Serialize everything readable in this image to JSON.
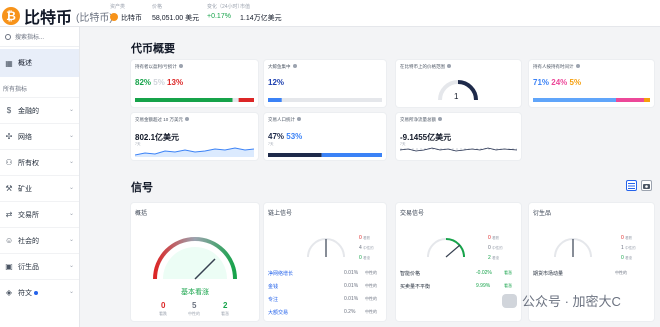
{
  "header": {
    "coin_symbol": "₿",
    "title": "比特币",
    "subtitle": "(比特币)",
    "stats": [
      {
        "label": "资产类",
        "value": "比特币"
      },
      {
        "label": "价格",
        "value": "58,051.00 美元"
      },
      {
        "label": "变化（24小时）",
        "value": "+0.17%"
      },
      {
        "label": "市值",
        "value": "1.14万亿美元"
      }
    ]
  },
  "sidebar": {
    "search_placeholder": "搜索指标...",
    "active_item": "概述",
    "section_title": "所有指标",
    "items": [
      {
        "label": "金融的",
        "icon": "dollar-icon",
        "glyph": "$"
      },
      {
        "label": "网络",
        "icon": "network-icon",
        "glyph": "✣"
      },
      {
        "label": "所有权",
        "icon": "ownership-icon",
        "glyph": "⚇"
      },
      {
        "label": "矿业",
        "icon": "mining-icon",
        "glyph": "⚒"
      },
      {
        "label": "交易所",
        "icon": "exchange-icon",
        "glyph": "⇄"
      },
      {
        "label": "社会的",
        "icon": "social-icon",
        "glyph": "☺"
      },
      {
        "label": "衍生品",
        "icon": "derivatives-icon",
        "glyph": "▣"
      },
      {
        "label": "符文",
        "icon": "runes-icon",
        "glyph": "◈"
      }
    ]
  },
  "overview": {
    "title": "代币概要",
    "cards": [
      {
        "title": "持有者以盈利/亏损计",
        "values": [
          "82%",
          "5%",
          "13%"
        ],
        "bar": [
          0.82,
          0.05,
          0.13
        ]
      },
      {
        "title": "大鲸鱼集中",
        "values": [
          "12%"
        ],
        "bar": [
          0.12
        ]
      },
      {
        "title": "在比特币上的价格范围",
        "gauge_value": "1"
      },
      {
        "title": "持有人按持有时间计",
        "values": [
          "71%",
          "24%",
          "5%"
        ],
        "bar": [
          0.71,
          0.24,
          0.05
        ]
      },
      {
        "title": "交易金额超过 10 万美元",
        "values": [
          "802.1亿美元"
        ],
        "sub": "7天"
      },
      {
        "title": "交易人口统计",
        "values": [
          "47%",
          "53%"
        ],
        "bar": [
          0.47,
          0.53
        ],
        "sub": "7天"
      },
      {
        "title": "交易所净流量总额",
        "values": [
          "-9.1455亿美元"
        ],
        "sub": "7天"
      }
    ]
  },
  "signals": {
    "title": "信号",
    "summary": {
      "title": "概括",
      "verdict": "基本看涨",
      "counts": [
        {
          "value": "0",
          "label": "看跌"
        },
        {
          "value": "5",
          "label": "中性的"
        },
        {
          "value": "2",
          "label": "看涨"
        }
      ]
    },
    "onchain": {
      "title": "链上信号",
      "counts": [
        {
          "value": "0",
          "label": "看跌"
        },
        {
          "value": "4",
          "label": "中性的"
        },
        {
          "value": "0",
          "label": "看涨"
        }
      ],
      "rows": [
        {
          "name": "净网络增长",
          "value": "0.01%",
          "status": "中性的"
        },
        {
          "name": "金钱",
          "value": "0.01%",
          "status": "中性的"
        },
        {
          "name": "专注",
          "value": "0.01%",
          "status": "中性的"
        },
        {
          "name": "大额交易",
          "value": "0.2%",
          "status": "中性的"
        }
      ]
    },
    "exchange": {
      "title": "交易信号",
      "counts": [
        {
          "value": "0",
          "label": "看跌"
        },
        {
          "value": "0",
          "label": "中性的"
        },
        {
          "value": "2",
          "label": "看涨"
        }
      ],
      "rows": [
        {
          "name": "智能价格",
          "value": "-0.02%",
          "status": "看涨"
        },
        {
          "name": "买卖量不平衡",
          "value": "9.99%",
          "status": "看涨"
        }
      ]
    },
    "derivatives": {
      "title": "衍生品",
      "counts": [
        {
          "value": "0",
          "label": "看跌"
        },
        {
          "value": "1",
          "label": "中性的"
        },
        {
          "value": "0",
          "label": "看涨"
        }
      ],
      "rows": [
        {
          "name": "期货市场动量",
          "value": "",
          "status": "中性的"
        }
      ]
    }
  },
  "watermark": "公众号 · 加密大C",
  "colors": {
    "green": "#16a34a",
    "red": "#dc2626",
    "orange": "#f59e0b",
    "blue": "#2563eb",
    "navy": "#1e2a4a",
    "pink": "#ec4899"
  }
}
